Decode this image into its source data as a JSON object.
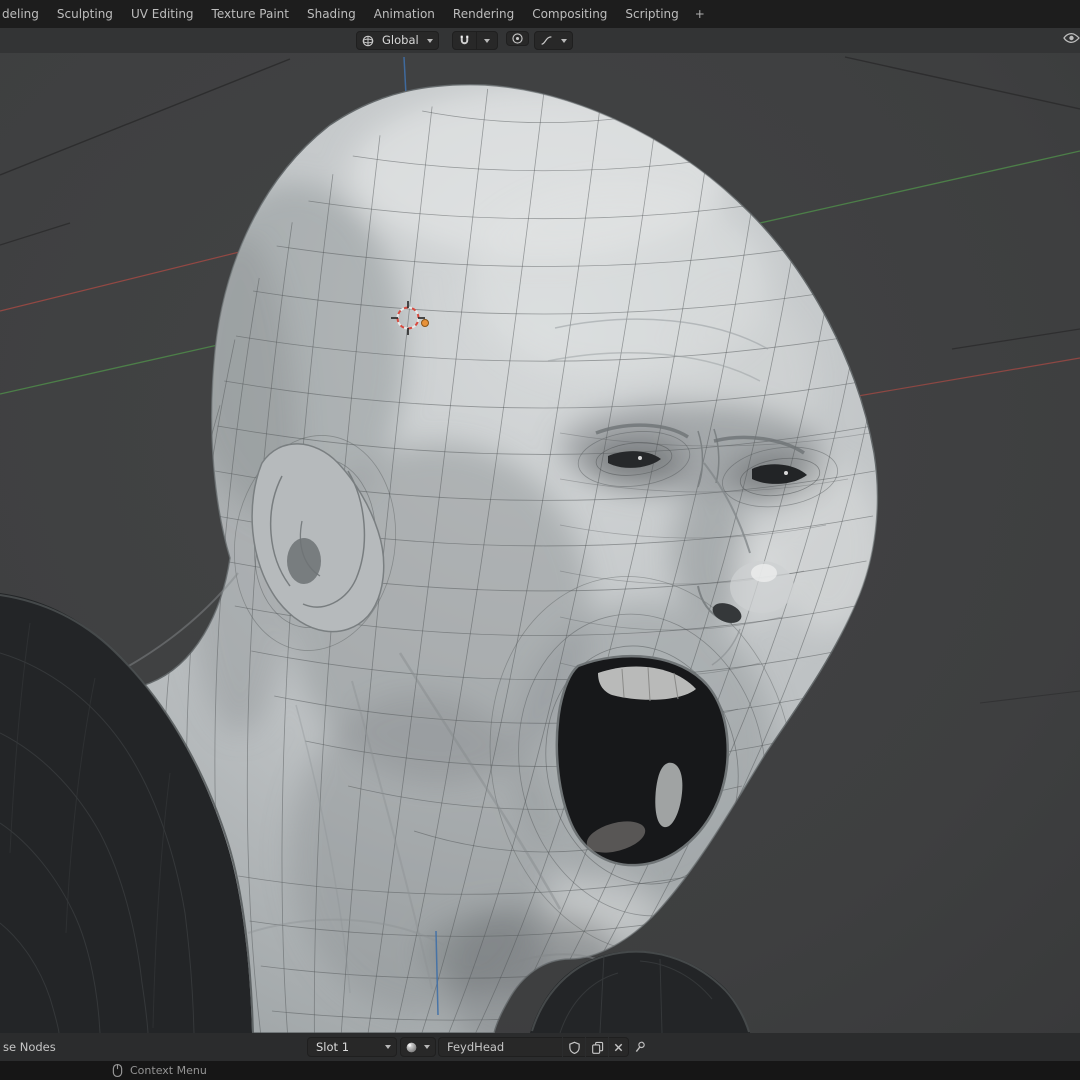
{
  "topbar": {
    "tabs": [
      "deling",
      "Sculpting",
      "UV Editing",
      "Texture Paint",
      "Shading",
      "Animation",
      "Rendering",
      "Compositing",
      "Scripting"
    ],
    "add_tab": "+"
  },
  "toolbar": {
    "orientation_label": "Global"
  },
  "bottombar": {
    "use_nodes_label": "se Nodes",
    "slot_label": "Slot 1",
    "material_name": "FeydHead"
  },
  "statusbar": {
    "context_menu_label": "Context Menu"
  },
  "icons": {
    "orientation": "global-orientation-icon",
    "snap": "magnet-icon",
    "snap_dropdown": "chevron-down-icon",
    "proportional": "proportional-editing-icon",
    "falloff": "falloff-curve-icon",
    "overlays": "eye-icon",
    "material_browse": "material-sphere-icon",
    "fake_user": "shield-icon",
    "duplicate": "copy-icon",
    "unlink": "close-icon",
    "pin": "pin-icon",
    "context_mouse": "mouse-icon",
    "viewport_cursor": "3d-cursor"
  },
  "colors": {
    "topbar_bg": "#1d1d1d",
    "toolbar_bg": "#333435",
    "viewport_bg": "#3f4041",
    "widget_bg": "#282828",
    "bottombar_bg": "#2b2c2d",
    "statusbar_bg": "#161616",
    "text": "#bfbfbf",
    "axis_green": "#4f8a4a",
    "axis_red": "#a84a44",
    "axis_blue": "#3f6fa8",
    "origin_orange": "#e8923a",
    "head_light": "#c9cccd",
    "head_dark": "#9da2a4"
  }
}
